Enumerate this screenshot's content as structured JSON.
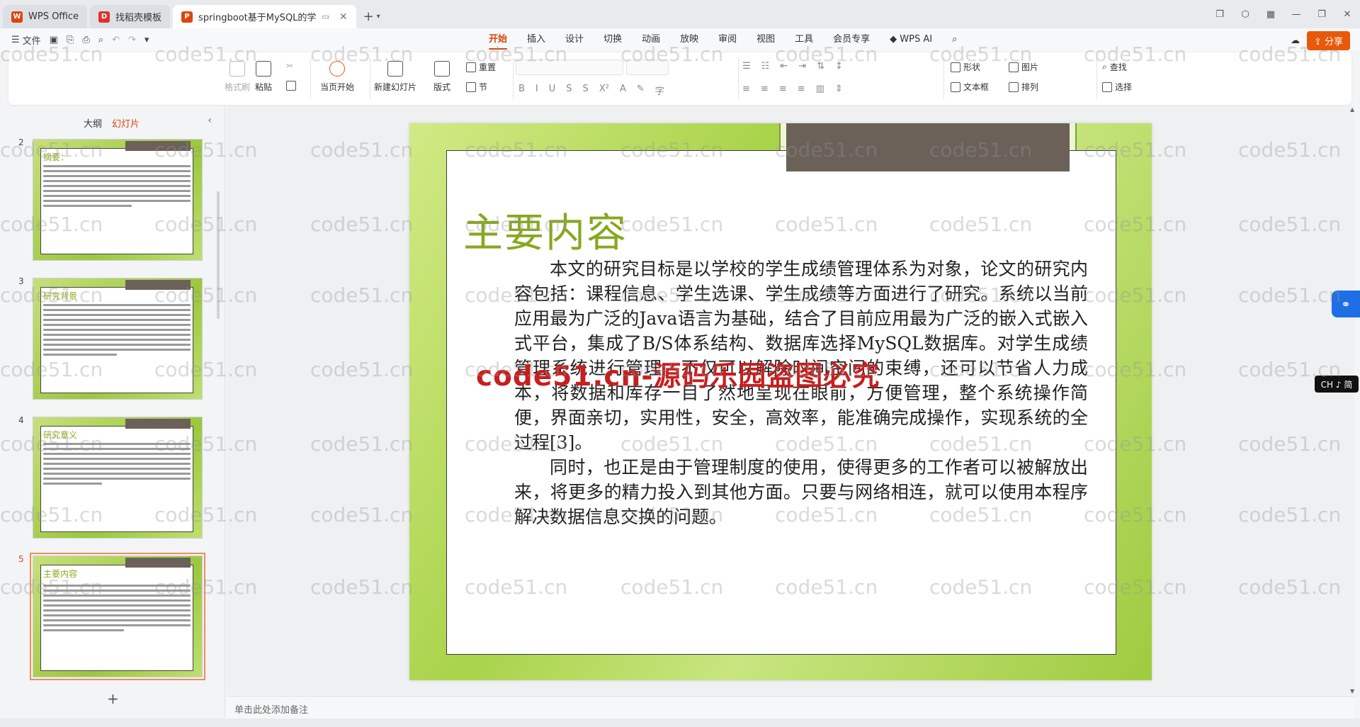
{
  "tabs": [
    {
      "label": "WPS Office",
      "logo": "W",
      "color": "#d9480f"
    },
    {
      "label": "找稻壳模板",
      "logo": "D",
      "color": "#e03131"
    },
    {
      "label": "springboot基于MySQL的学",
      "logo": "P",
      "color": "#d9480f"
    }
  ],
  "menu": {
    "file": "文件",
    "tabs": [
      "开始",
      "插入",
      "设计",
      "切换",
      "动画",
      "放映",
      "审阅",
      "视图",
      "工具",
      "会员专享"
    ],
    "active_tab": "开始",
    "wps_ai": "WPS AI",
    "share": "分享"
  },
  "ribbon": {
    "format_painter": "格式刷",
    "paste": "粘贴",
    "play_from_current": "当页开始",
    "new_slide": "新建幻灯片",
    "layout": "版式",
    "reset": "重置",
    "section": "节",
    "shape": "形状",
    "picture": "图片",
    "textbox": "文本框",
    "arrange": "排列",
    "find": "查找",
    "select": "选择"
  },
  "left_panel": {
    "tab_outline": "大纲",
    "tab_slides": "幻灯片",
    "thumbnails": [
      {
        "num": "2",
        "title": "摘要：",
        "selected": false
      },
      {
        "num": "3",
        "title": "研究背景",
        "selected": false
      },
      {
        "num": "4",
        "title": "研究意义",
        "selected": false
      },
      {
        "num": "5",
        "title": "主要内容",
        "selected": true
      }
    ],
    "add": "+"
  },
  "slide": {
    "title": "主要内容",
    "para1": "本文的研究目标是以学校的学生成绩管理体系为对象，论文的研究内容包括：课程信息、学生选课、学生成绩等方面进行了研究。系统以当前应用最为广泛的Java语言为基础，结合了目前应用最为广泛的嵌入式嵌入式平台，集成了B/S体系结构、数据库选择MySQL数据库。对学生成绩管理系统进行管理，不仅可以解除时间空间的束缚，还可以节省人力成本，将数据和库存一目了然地呈现在眼前，方便管理，整个系统操作简便，界面亲切，实用性，安全，高效率，能准确完成操作，实现系统的全过程[3]。",
    "para2": "同时，也正是由于管理制度的使用，使得更多的工作者可以被解放出来，将更多的精力投入到其他方面。只要与网络相连，就可以使用本程序解决数据信息交换的问题。",
    "overlay_text": "code51.cn-源码乐园盗图必究"
  },
  "watermark": "code51.cn",
  "notes_placeholder": "单击此处添加备注",
  "ime": "CH ♪ 简"
}
